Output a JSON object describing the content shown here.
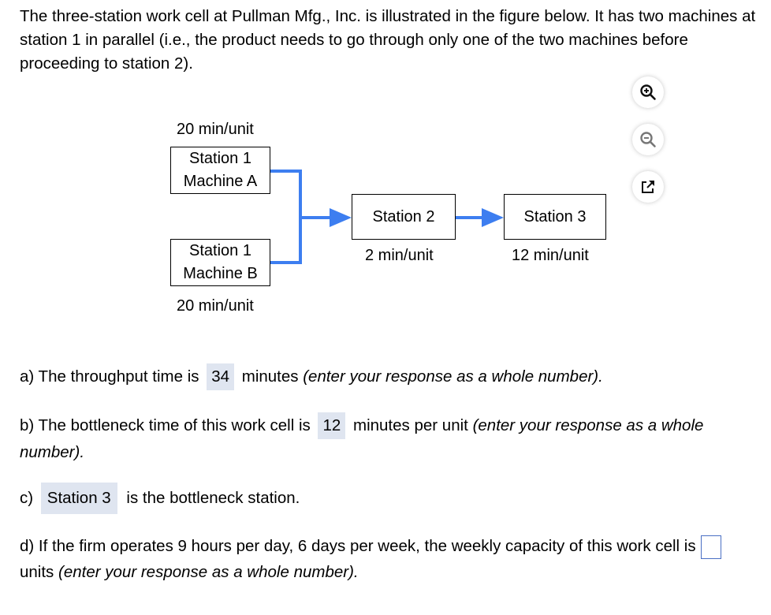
{
  "intro": {
    "text": "The three-station work cell at Pullman Mfg., Inc. is illustrated in the figure below. It has two machines at station 1 in parallel (i.e., the product needs to go through only one of the two machines before proceeding to station 2)."
  },
  "figure": {
    "machine_a": {
      "line1": "Station 1",
      "line2": "Machine A",
      "time": "20 min/unit"
    },
    "machine_b": {
      "line1": "Station 1",
      "line2": "Machine B",
      "time": "20 min/unit"
    },
    "station2": {
      "label": "Station 2",
      "time": "2 min/unit"
    },
    "station3": {
      "label": "Station 3",
      "time": "12 min/unit"
    },
    "connector_color": "#3d7ef0",
    "tools": {
      "zoom_in": "zoom-in-icon",
      "zoom_out": "zoom-out-icon",
      "open_external": "open-external-icon"
    }
  },
  "questions": {
    "a": {
      "prefix": "a) The throughput time is",
      "answer": "34",
      "suffix": "minutes",
      "hint": "(enter your response as a whole number)."
    },
    "b": {
      "prefix": "b) The bottleneck time of this work cell is",
      "answer": "12",
      "suffix": "minutes per unit",
      "hint": "(enter your response as a whole number)."
    },
    "c": {
      "prefix": "c)",
      "answer": "Station 3",
      "suffix": "is the bottleneck station."
    },
    "d": {
      "prefix": "d) If the firm operates 9 hours per day, 6 days per week, the weekly capacity of this work cell is",
      "value": "",
      "suffix": "units",
      "hint": "(enter your response as a whole number)."
    }
  }
}
